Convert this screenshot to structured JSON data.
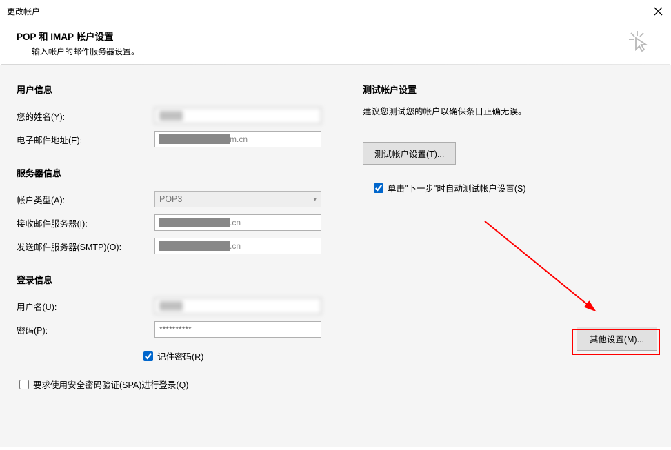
{
  "window": {
    "title": "更改帐户"
  },
  "header": {
    "main": "POP 和 IMAP 帐户设置",
    "sub": "输入帐户的邮件服务器设置。"
  },
  "sections": {
    "user_info": "用户信息",
    "server_info": "服务器信息",
    "login_info": "登录信息",
    "test_title": "测试帐户设置",
    "test_desc": "建议您测试您的帐户以确保条目正确无误。"
  },
  "labels": {
    "your_name": "您的姓名(Y):",
    "email": "电子邮件地址(E):",
    "account_type": "帐户类型(A):",
    "incoming": "接收邮件服务器(I):",
    "outgoing": "发送邮件服务器(SMTP)(O):",
    "username": "用户名(U):",
    "password": "密码(P):",
    "remember": "记住密码(R)",
    "spa": "要求使用安全密码验证(SPA)进行登录(Q)",
    "auto_test": "单击\"下一步\"时自动测试帐户设置(S)"
  },
  "values": {
    "your_name": "████",
    "email": "████████████m.cn",
    "account_type": "POP3",
    "incoming": "████████████.cn",
    "outgoing": "████████████.cn",
    "username": "████",
    "password": "**********"
  },
  "buttons": {
    "test": "测试帐户设置(T)...",
    "other": "其他设置(M)..."
  },
  "checks": {
    "remember": true,
    "spa": false,
    "auto_test": true
  }
}
